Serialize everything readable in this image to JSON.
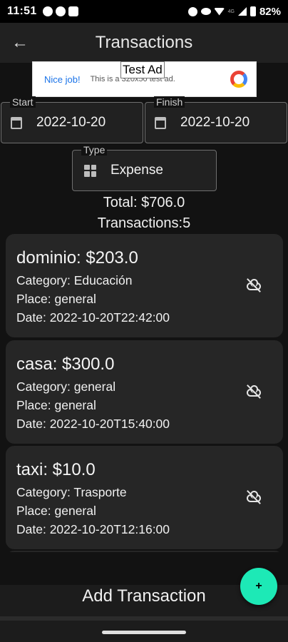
{
  "status_bar": {
    "time": "11:51",
    "lte": "4G",
    "battery": "82%"
  },
  "app_bar": {
    "title": "Transactions",
    "back_icon": "←"
  },
  "ad": {
    "label": "Test Ad",
    "nice": "Nice job!",
    "text": "This is a 320x50 test ad."
  },
  "filters": {
    "start": {
      "label": "Start",
      "value": "2022-10-20"
    },
    "finish": {
      "label": "Finish",
      "value": "2022-10-20"
    },
    "type": {
      "label": "Type",
      "value": "Expense"
    }
  },
  "summary": {
    "total": "Total: $706.0",
    "count": "Transactions:5"
  },
  "transactions": [
    {
      "title": "dominio: $203.0",
      "category": "Category: Educación",
      "place": "Place: general",
      "date": "Date: 2022-10-20T22:42:00"
    },
    {
      "title": "casa: $300.0",
      "category": "Category: general",
      "place": "Place: general",
      "date": "Date: 2022-10-20T15:40:00"
    },
    {
      "title": "taxi: $10.0",
      "category": "Category: Trasporte",
      "place": "Place: general",
      "date": "Date: 2022-10-20T12:16:00"
    }
  ],
  "actions": {
    "add_transaction": "Add Transaction",
    "fab_label": "+"
  },
  "colors": {
    "accent": "#1de9b6",
    "background": "#121212",
    "card": "#262626"
  }
}
